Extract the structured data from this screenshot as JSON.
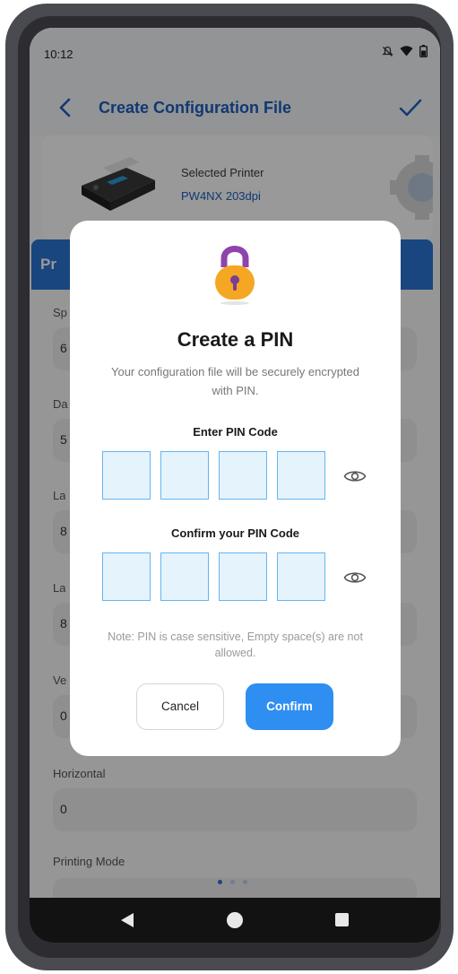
{
  "status_bar": {
    "time": "10:12",
    "icons": [
      "notifications-off-icon",
      "wifi-icon",
      "battery-icon"
    ]
  },
  "app_bar": {
    "title": "Create Configuration File",
    "back_icon": "chevron-left-icon",
    "confirm_icon": "check-icon"
  },
  "printer": {
    "label": "Selected Printer",
    "name": "PW4NX 203dpi"
  },
  "section": {
    "title": "Pr"
  },
  "fields": [
    {
      "label": "Sp",
      "value": "6"
    },
    {
      "label": "Da",
      "value": "5"
    },
    {
      "label": "La",
      "value": "8"
    },
    {
      "label": "La",
      "value": "8"
    },
    {
      "label": "Ve",
      "value": "0"
    },
    {
      "label": "Horizontal",
      "value": "0"
    },
    {
      "label": "Printing Mode",
      "value": ""
    }
  ],
  "pin_dialog": {
    "title": "Create a PIN",
    "description": "Your configuration file will be securely encrypted with PIN.",
    "enter_label": "Enter PIN Code",
    "confirm_label": "Confirm your PIN Code",
    "note": "Note: PIN is case sensitive, Empty space(s) are not allowed.",
    "cancel_button": "Cancel",
    "confirm_button": "Confirm",
    "enter_pin_digits": [
      "",
      "",
      "",
      ""
    ],
    "confirm_pin_digits": [
      "",
      "",
      "",
      ""
    ]
  },
  "pager": {
    "count": 3,
    "active": 0
  },
  "colors": {
    "primary": "#2b76d4",
    "title_blue": "#1b5fbe",
    "confirm_button": "#2e8ef2",
    "pin_box_fill": "#e5f3fd",
    "pin_box_border": "#66b5ef",
    "lock_body": "#f5a623",
    "lock_shackle": "#8e44ad"
  }
}
